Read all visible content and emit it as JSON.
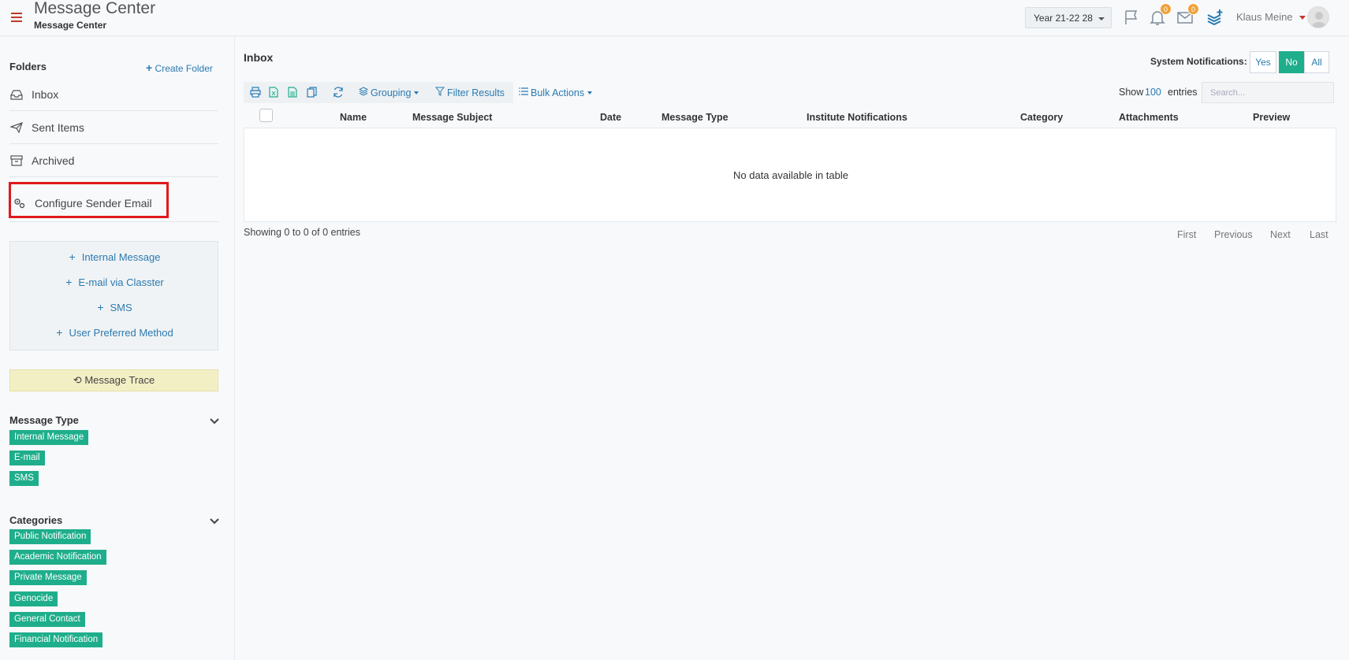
{
  "header": {
    "title": "Message Center",
    "subtitle": "Message Center",
    "year": "Year 21-22 28",
    "notifications_count": "0",
    "messages_count": "0",
    "user_name": "Klaus Meine"
  },
  "sidebar": {
    "folders_title": "Folders",
    "create_folder": "Create Folder",
    "folders": [
      {
        "label": "Inbox",
        "icon": "inbox-icon"
      },
      {
        "label": "Sent Items",
        "icon": "paper-plane-icon"
      },
      {
        "label": "Archived",
        "icon": "archive-icon"
      },
      {
        "label": "Configure Sender Email",
        "icon": "cogs-icon"
      }
    ],
    "compose": [
      {
        "label": "Internal Message"
      },
      {
        "label": "E-mail via Classter"
      },
      {
        "label": "SMS"
      },
      {
        "label": "User Preferred Method"
      }
    ],
    "trace_label": "Message Trace",
    "message_type_title": "Message Type",
    "message_types": [
      "Internal Message",
      "E-mail",
      "SMS"
    ],
    "categories_title": "Categories",
    "categories": [
      "Public Notification",
      "Academic Notification",
      "Private Message",
      "Genocide",
      "General Contact",
      "Financial Notification"
    ]
  },
  "main": {
    "title": "Inbox",
    "system_notifications_label": "System Notifications:",
    "system_notifications_options": [
      "Yes",
      "No",
      "All"
    ],
    "system_notifications_selected": "No",
    "toolbar": {
      "grouping": "Grouping",
      "filter": "Filter Results",
      "bulk": "Bulk Actions"
    },
    "show_label": "Show",
    "show_count": "100",
    "entries_label": "entries",
    "search_placeholder": "Search...",
    "columns": [
      "Name",
      "Message Subject",
      "Date",
      "Message Type",
      "Institute Notifications",
      "Category",
      "Attachments",
      "Preview"
    ],
    "empty_text": "No data available in table",
    "showing_text": "Showing 0 to 0 of 0 entries",
    "pager": [
      "First",
      "Previous",
      "Next",
      "Last"
    ]
  },
  "colors": {
    "accent": "#1fae8b",
    "link": "#2a7ab0",
    "highlight": "#e01a1a",
    "brand_red": "#c0392b"
  }
}
